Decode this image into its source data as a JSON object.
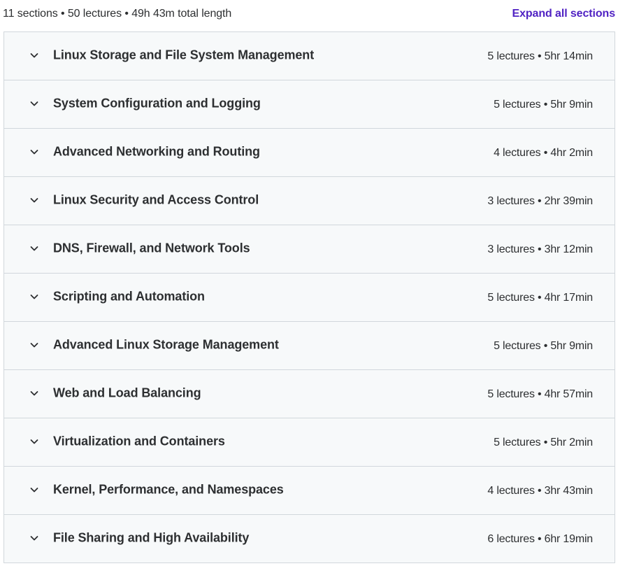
{
  "summary": {
    "text": "11 sections • 50 lectures • 49h 43m total length",
    "expand_label": "Expand all sections"
  },
  "colors": {
    "accent": "#5022c3",
    "row_bg": "#f7f9fa",
    "border": "#d1d7dc",
    "text": "#2d2f31"
  },
  "sections": [
    {
      "title": "Linux Storage and File System Management",
      "meta": "5 lectures • 5hr 14min",
      "icon": "chevron-down-icon"
    },
    {
      "title": "System Configuration and Logging",
      "meta": "5 lectures • 5hr 9min",
      "icon": "chevron-down-icon"
    },
    {
      "title": "Advanced Networking and Routing",
      "meta": "4 lectures • 4hr 2min",
      "icon": "chevron-down-icon"
    },
    {
      "title": "Linux Security and Access Control",
      "meta": "3 lectures • 2hr 39min",
      "icon": "chevron-down-icon"
    },
    {
      "title": "DNS, Firewall, and Network Tools",
      "meta": "3 lectures • 3hr 12min",
      "icon": "chevron-down-icon"
    },
    {
      "title": "Scripting and Automation",
      "meta": "5 lectures • 4hr 17min",
      "icon": "chevron-down-icon"
    },
    {
      "title": "Advanced Linux Storage Management",
      "meta": "5 lectures • 5hr 9min",
      "icon": "chevron-down-icon"
    },
    {
      "title": "Web and Load Balancing",
      "meta": "5 lectures • 4hr 57min",
      "icon": "chevron-down-icon"
    },
    {
      "title": "Virtualization and Containers",
      "meta": "5 lectures • 5hr 2min",
      "icon": "chevron-down-icon"
    },
    {
      "title": "Kernel, Performance, and Namespaces",
      "meta": "4 lectures • 3hr 43min",
      "icon": "chevron-down-icon"
    },
    {
      "title": "File Sharing and High Availability",
      "meta": "6 lectures • 6hr 19min",
      "icon": "chevron-down-icon"
    }
  ]
}
